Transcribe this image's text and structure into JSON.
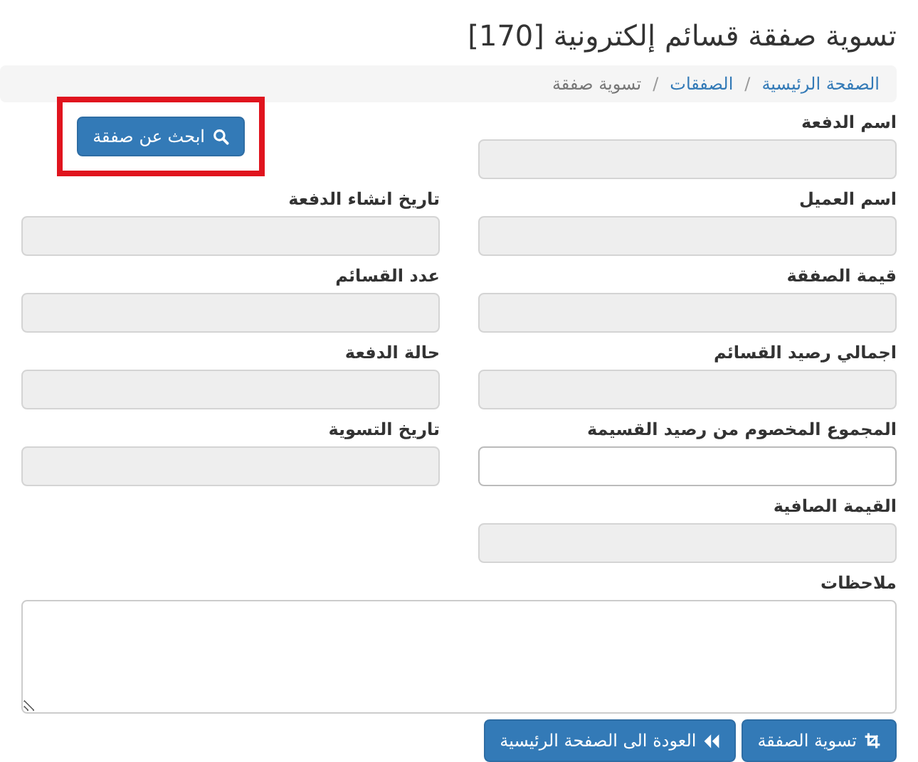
{
  "page_title": "تسوية صفقة قسائم إلكترونية [170]",
  "breadcrumb": [
    {
      "kind": "link",
      "label": "الصفحة الرئيسية"
    },
    {
      "kind": "separator",
      "label": "/"
    },
    {
      "kind": "link",
      "label": "الصفقات"
    },
    {
      "kind": "separator",
      "label": "/"
    },
    {
      "kind": "current",
      "label": "تسوية صفقة"
    }
  ],
  "search_button": {
    "label": "ابحث عن صفقة",
    "highlighted": true
  },
  "rows": [
    {
      "right": {
        "label": "اسم الدفعة",
        "disabled": true
      },
      "left": {
        "kind": "button"
      }
    },
    {
      "right": {
        "label": "اسم العميل",
        "disabled": true
      },
      "left": {
        "kind": "field",
        "label": "تاريخ انشاء الدفعة",
        "disabled": true
      }
    },
    {
      "right": {
        "label": "قيمة الصفقة",
        "disabled": true
      },
      "left": {
        "kind": "field",
        "label": "عدد القسائم",
        "disabled": true
      }
    },
    {
      "right": {
        "label": "اجمالي رصيد القسائم",
        "disabled": true
      },
      "left": {
        "kind": "field",
        "label": "حالة الدفعة",
        "disabled": true
      }
    },
    {
      "right": {
        "label": "المجموع المخصوم من رصيد القسيمة",
        "disabled": false
      },
      "left": {
        "kind": "field",
        "label": "تاريخ التسوية",
        "disabled": true
      }
    },
    {
      "right": {
        "label": "القيمة الصافية",
        "disabled": true
      },
      "left": {
        "kind": "empty"
      }
    }
  ],
  "notes": {
    "label": "ملاحظات"
  },
  "actions": [
    {
      "label": "تسوية الصفقة",
      "kind": "settle"
    },
    {
      "label": "العودة الى الصفحة الرئيسية",
      "kind": "back"
    }
  ]
}
